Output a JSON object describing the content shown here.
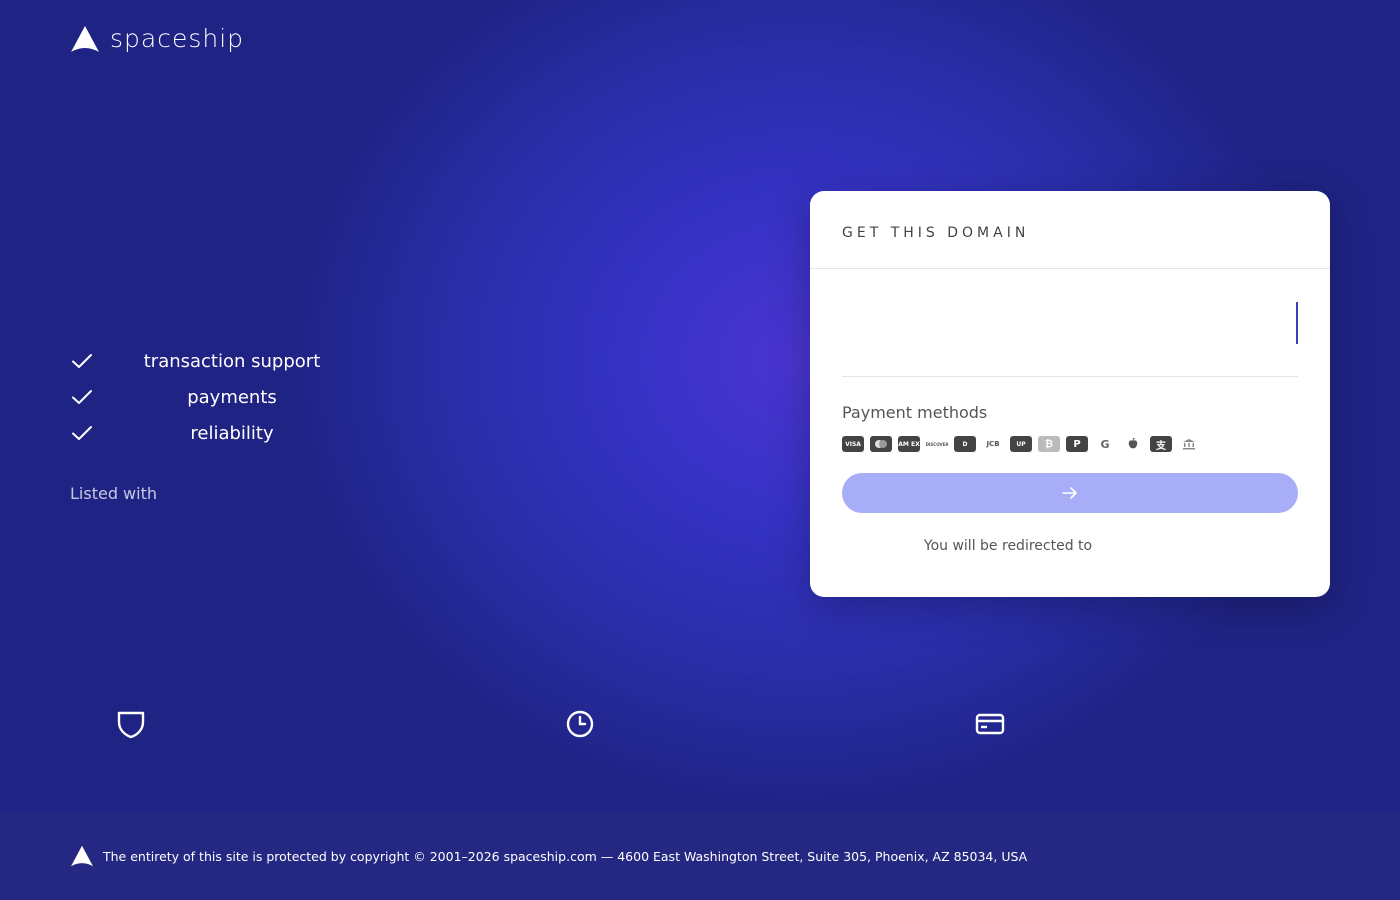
{
  "brand": {
    "name": "spaceship",
    "logo_icon": "spaceship-logo-icon"
  },
  "features": [
    {
      "label": "transaction support",
      "icon": "check-icon"
    },
    {
      "label": "payments",
      "icon": "check-icon"
    },
    {
      "label": "reliability",
      "icon": "check-icon"
    }
  ],
  "listed_with": "Listed with",
  "card": {
    "title": "GET THIS DOMAIN",
    "payment_methods_label": "Payment methods",
    "payment_methods": [
      {
        "name": "visa",
        "text": "VISA"
      },
      {
        "name": "mastercard",
        "text": ""
      },
      {
        "name": "amex",
        "text": "AM EX"
      },
      {
        "name": "discover",
        "text": "DISCOVER"
      },
      {
        "name": "diners",
        "text": "D"
      },
      {
        "name": "jcb",
        "text": "JCB"
      },
      {
        "name": "unionpay",
        "text": "UP"
      },
      {
        "name": "bitcoin",
        "text": "₿"
      },
      {
        "name": "paypal",
        "text": "P"
      },
      {
        "name": "google-pay",
        "text": "G"
      },
      {
        "name": "apple-pay",
        "text": ""
      },
      {
        "name": "alipay",
        "text": "支"
      },
      {
        "name": "bank-transfer",
        "text": ""
      }
    ],
    "buy_button_icon": "arrow-right-icon",
    "redirect_text": "You will be redirected to"
  },
  "bottom_icons": [
    "shield-icon",
    "clock-icon",
    "credit-card-icon"
  ],
  "footer": {
    "text": "The entirety of this site is protected by copyright © 2001–2026 spaceship.com — 4600 East Washington Street, Suite 305, Phoenix, AZ 85034, USA"
  },
  "colors": {
    "background": "#1f2384",
    "glow": "#4a34d0",
    "button": "#a7adf7",
    "card": "#ffffff"
  }
}
